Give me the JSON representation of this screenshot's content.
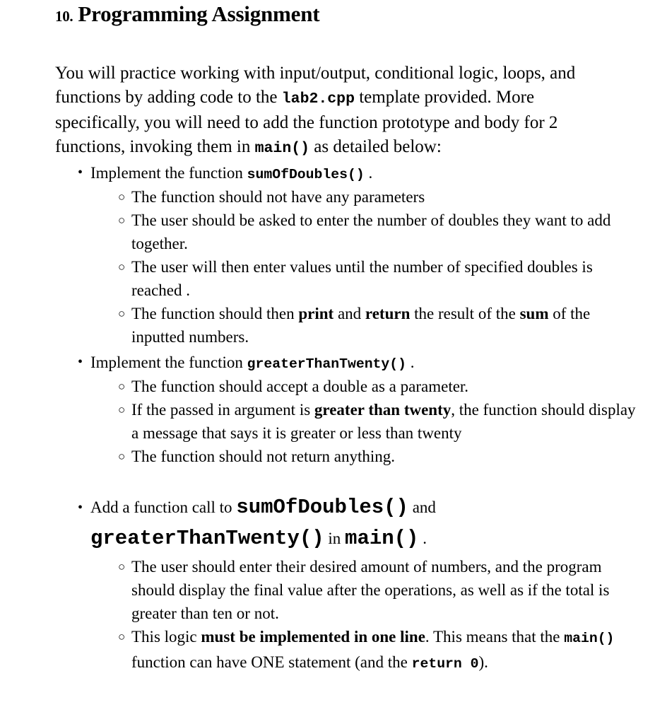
{
  "document": {
    "heading": {
      "number": "10.",
      "title": "Programming Assignment"
    },
    "intro": {
      "part1": "You will practice working with input/output, conditional logic, loops, and functions by adding code to the ",
      "code1": "lab2.cpp",
      "part2": " template provided. More specifically, you will need to add the function prototype and body for 2 functions, invoking them in ",
      "code2": "main()",
      "part3": " as detailed below:"
    },
    "bullets": [
      {
        "marker": "•",
        "text_before": "Implement the function ",
        "code": "sumOfDoubles()",
        "text_after": " .",
        "subitems": [
          {
            "marker": "○",
            "part1": "The function should not have any parameters"
          },
          {
            "marker": "○",
            "part1": "The user should be asked to enter the number of doubles they want to add together."
          },
          {
            "marker": "○",
            "part1": "The user will then enter values until the number of specified doubles is reached ."
          },
          {
            "marker": "○",
            "part1": "The function should then ",
            "bold1": "print",
            "part2": " and ",
            "bold2": "return",
            "part3": " the result of the ",
            "bold3": "sum",
            "part4": " of the inputted numbers."
          }
        ]
      },
      {
        "marker": "•",
        "text_before": "Implement the function ",
        "code": "greaterThanTwenty()",
        "text_after": " .",
        "subitems": [
          {
            "marker": "○",
            "part1": "The function should accept a double as a parameter."
          },
          {
            "marker": "○",
            "part1": "If the passed in argument is ",
            "bold1": "greater than twenty",
            "part2": ", the function should display a message that says it is greater or less than twenty"
          },
          {
            "marker": "○",
            "part1": "The function should not return anything."
          }
        ]
      },
      {
        "marker": "•",
        "text_before": "Add a function call to ",
        "code_big1": "sumOfDoubles()",
        "text_mid1": " and ",
        "code_big2": "greaterThanTwenty()",
        "text_mid2": " in ",
        "code_big3": "main()",
        "text_after": " .",
        "subitems": [
          {
            "marker": "○",
            "part1": "The user should enter their desired amount of numbers, and the program should display the final value after the operations, as well as if the total is greater than ten or not."
          },
          {
            "marker": "○",
            "part1": "This logic ",
            "bold1": "must be implemented in one line",
            "part2": ". This means that the ",
            "code1": "main()",
            "part3": " function can have ONE statement (and the ",
            "code2": "return 0",
            "part4": ")."
          }
        ]
      }
    ]
  }
}
